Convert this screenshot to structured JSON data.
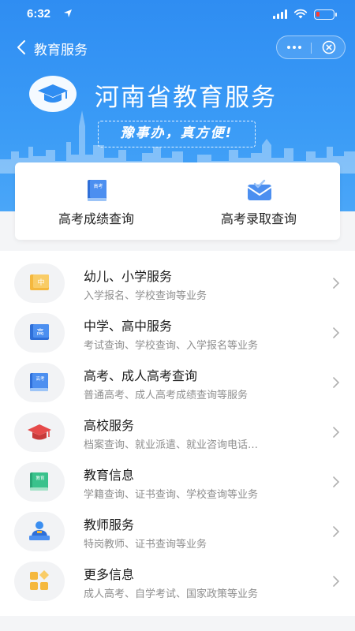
{
  "status_bar": {
    "time": "6:32",
    "battery_level": 0.2
  },
  "nav": {
    "back_label": "教育服务"
  },
  "brand": {
    "title": "河南省教育服务",
    "slogan": "豫事办，真方便!"
  },
  "quick_actions": [
    {
      "label": "高考成绩查询",
      "icon": "book-icon",
      "icon_text": "高考"
    },
    {
      "label": "高考录取查询",
      "icon": "envelope-icon"
    }
  ],
  "services": [
    {
      "title": "幼儿、小学服务",
      "subtitle": "入学报名、学校查询等业务",
      "icon": "primary-school-icon",
      "icon_text": "中"
    },
    {
      "title": "中学、高中服务",
      "subtitle": "考试查询、学校查询、入学报名等业务",
      "icon": "high-school-icon",
      "icon_text": "高"
    },
    {
      "title": "高考、成人高考查询",
      "subtitle": "普通高考、成人高考成绩查询等服务",
      "icon": "exam-book-icon",
      "icon_text": "高考"
    },
    {
      "title": "高校服务",
      "subtitle": "档案查询、就业派遣、就业咨询电话…",
      "icon": "graduation-cap-icon"
    },
    {
      "title": "教育信息",
      "subtitle": "学籍查询、证书查询、学校查询等业务",
      "icon": "education-book-icon",
      "icon_text": "教育"
    },
    {
      "title": "教师服务",
      "subtitle": "特岗教师、证书查询等业务",
      "icon": "teacher-icon"
    },
    {
      "title": "更多信息",
      "subtitle": "成人高考、自学考试、国家政策等业务",
      "icon": "grid-icon"
    }
  ],
  "colors": {
    "header_blue": "#2f8df2",
    "accent_orange": "#f5b83d",
    "accent_blue": "#3b8ef0",
    "accent_red": "#e64a4a",
    "accent_green": "#3ac28c"
  }
}
